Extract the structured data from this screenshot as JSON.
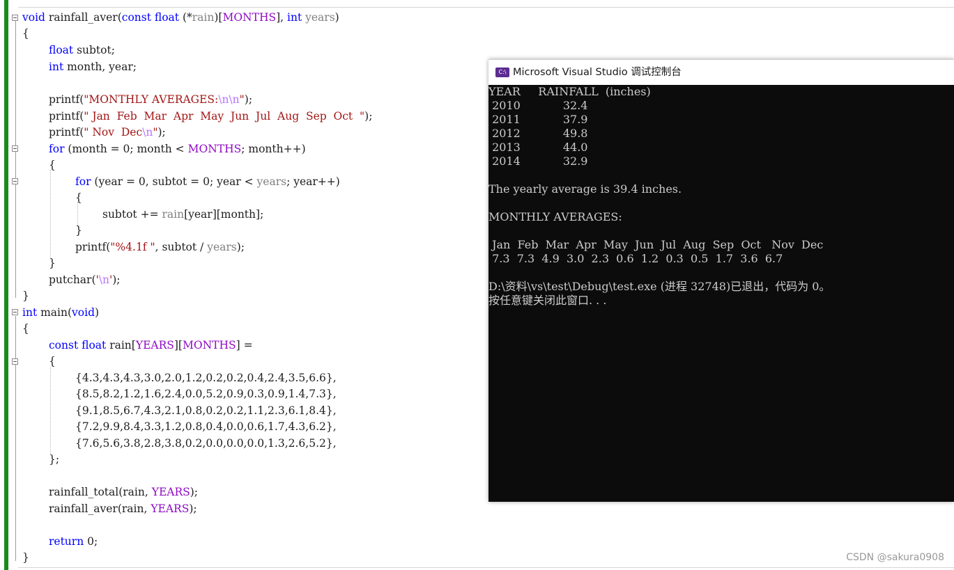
{
  "code": {
    "lines": {
      "l1_a": "void",
      "l1_b": " rainfall_aver(",
      "l1_c": "const",
      "l1_d": " ",
      "l1_e": "float",
      "l1_f": " (*",
      "l1_g": "rain",
      "l1_h": ")[",
      "l1_i": "MONTHS",
      "l1_j": "], ",
      "l1_k": "int",
      "l1_l": " ",
      "l1_m": "years",
      "l1_n": ")",
      "l2": "{",
      "l3_a": "float",
      "l3_b": " subtot;",
      "l4_a": "int",
      "l4_b": " month, year;",
      "l6_a": "printf(",
      "l6_b": "\"MONTHLY AVERAGES:",
      "l6_c": "\\n\\n",
      "l6_d": "\"",
      "l6_e": ");",
      "l7_a": "printf(",
      "l7_b": "\" Jan  Feb  Mar  Apr  May  Jun  Jul  Aug  Sep  Oct  \"",
      "l7_c": ");",
      "l8_a": "printf(",
      "l8_b": "\" Nov  Dec",
      "l8_c": "\\n",
      "l8_d": "\"",
      "l8_e": ");",
      "l9_a": "for",
      "l9_b": " (month = 0; month < ",
      "l9_c": "MONTHS",
      "l9_d": "; month++)",
      "l10": "{",
      "l11_a": "for",
      "l11_b": " (year = 0, subtot = 0; year < ",
      "l11_c": "years",
      "l11_d": "; year++)",
      "l12": "{",
      "l13_a": "subtot += ",
      "l13_b": "rain",
      "l13_c": "[year][month];",
      "l14": "}",
      "l15_a": "printf(",
      "l15_b": "\"%4.1f \"",
      "l15_c": ", subtot / ",
      "l15_d": "years",
      "l15_e": ");",
      "l16": "}",
      "l17_a": "putchar(",
      "l17_b": "'",
      "l17_c": "\\n",
      "l17_d": "'",
      "l17_e": ");",
      "l18": "}",
      "l19_a": "int",
      "l19_b": " main(",
      "l19_c": "void",
      "l19_d": ")",
      "l20": "{",
      "l21_a": "const",
      "l21_b": " ",
      "l21_c": "float",
      "l21_d": " rain[",
      "l21_e": "YEARS",
      "l21_f": "][",
      "l21_g": "MONTHS",
      "l21_h": "] =",
      "l22": "{",
      "l23": "{4.3,4.3,4.3,3.0,2.0,1.2,0.2,0.2,0.4,2.4,3.5,6.6},",
      "l24": "{8.5,8.2,1.2,1.6,2.4,0.0,5.2,0.9,0.3,0.9,1.4,7.3},",
      "l25": "{9.1,8.5,6.7,4.3,2.1,0.8,0.2,0.2,1.1,2.3,6.1,8.4},",
      "l26": "{7.2,9.9,8.4,3.3,1.2,0.8,0.4,0.0,0.6,1.7,4.3,6.2},",
      "l27": "{7.6,5.6,3.8,2.8,3.8,0.2,0.0,0.0,0.0,1.3,2.6,5.2},",
      "l28": "};",
      "l30_a": "rainfall_total(rain, ",
      "l30_b": "YEARS",
      "l30_c": ");",
      "l31_a": "rainfall_aver(rain, ",
      "l31_b": "YEARS",
      "l31_c": ");",
      "l33_a": "return",
      "l33_b": " 0;",
      "l34": "}"
    }
  },
  "console": {
    "icon_label": "C:\\",
    "title": "Microsoft Visual Studio 调试控制台",
    "lines": [
      "YEAR     RAINFALL  (inches)",
      " 2010            32.4",
      " 2011            37.9",
      " 2012            49.8",
      " 2013            44.0",
      " 2014            32.9",
      "",
      "The yearly average is 39.4 inches.",
      "",
      "MONTHLY AVERAGES:",
      "",
      " Jan  Feb  Mar  Apr  May  Jun  Jul  Aug  Sep  Oct   Nov  Dec",
      " 7.3  7.3  4.9  3.0  2.3  0.6  1.2  0.3  0.5  1.7  3.6  6.7",
      "",
      "D:\\资料\\vs\\test\\Debug\\test.exe (进程 32748)已退出，代码为 0。",
      "按任意键关闭此窗口. . ."
    ]
  },
  "watermark": "CSDN @sakura0908",
  "colors": {
    "keyword": "#0000ff",
    "string": "#a31515",
    "macro": "#8f08c4",
    "parameter": "#808080",
    "escape": "#b776fb",
    "change_bar": "#1a8a1a",
    "console_bg": "#0c0c0c",
    "console_text": "#cccccc"
  }
}
